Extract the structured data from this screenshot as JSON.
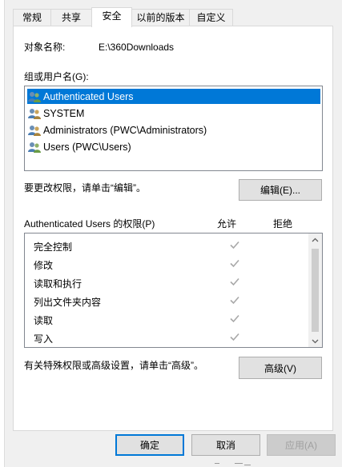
{
  "tabs": [
    {
      "label": "常规",
      "active": false
    },
    {
      "label": "共享",
      "active": false
    },
    {
      "label": "安全",
      "active": true
    },
    {
      "label": "以前的版本",
      "active": false
    },
    {
      "label": "自定义",
      "active": false
    }
  ],
  "object_name": {
    "label": "对象名称:",
    "value": "E:\\360Downloads"
  },
  "groups": {
    "label": "组或用户名(G):",
    "items": [
      {
        "name": "Authenticated Users",
        "selected": true
      },
      {
        "name": "SYSTEM",
        "selected": false
      },
      {
        "name": "Administrators (PWC\\Administrators)",
        "selected": false
      },
      {
        "name": "Users (PWC\\Users)",
        "selected": false
      }
    ]
  },
  "change_hint": "要更改权限，请单击“编辑”。",
  "edit_button": "编辑(E)...",
  "permissions": {
    "header": "Authenticated Users 的权限(P)",
    "allow_label": "允许",
    "deny_label": "拒绝",
    "items": [
      {
        "name": "完全控制",
        "allow": true
      },
      {
        "name": "修改",
        "allow": true
      },
      {
        "name": "读取和执行",
        "allow": true
      },
      {
        "name": "列出文件夹内容",
        "allow": true
      },
      {
        "name": "读取",
        "allow": true
      },
      {
        "name": "写入",
        "allow": true
      }
    ]
  },
  "advanced_hint": "有关特殊权限或高级设置，请单击“高级”。",
  "advanced_button": "高级(V)",
  "footer": {
    "ok": "确定",
    "cancel": "取消",
    "apply": "应用(A)"
  },
  "colors": {
    "selection": "#0078d7",
    "check": "#a8a8a8"
  }
}
